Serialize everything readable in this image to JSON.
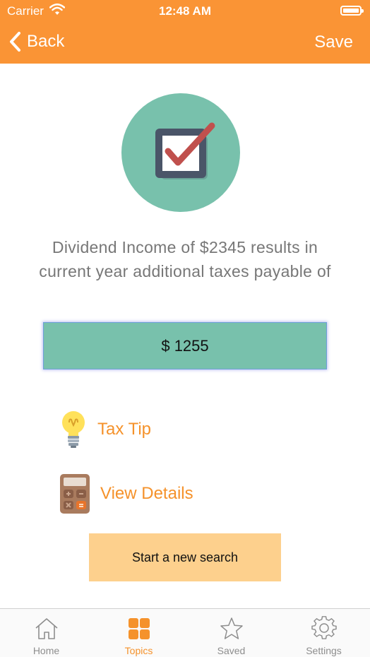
{
  "status_bar": {
    "carrier": "Carrier",
    "time": "12:48 AM"
  },
  "nav": {
    "back_label": "Back",
    "save_label": "Save"
  },
  "result": {
    "message": "Dividend Income of $2345 results in current year additional taxes payable of",
    "amount": "$ 1255"
  },
  "links": {
    "tax_tip": "Tax Tip",
    "view_details": "View Details"
  },
  "new_search_label": "Start a new search",
  "tabs": [
    {
      "label": "Home",
      "icon": "home-icon"
    },
    {
      "label": "Topics",
      "icon": "grid-icon",
      "active": true
    },
    {
      "label": "Saved",
      "icon": "star-icon"
    },
    {
      "label": "Settings",
      "icon": "gear-icon"
    }
  ],
  "colors": {
    "brand_orange": "#FA9435",
    "teal": "#78C1AC",
    "button_peach": "#FDD08D"
  }
}
